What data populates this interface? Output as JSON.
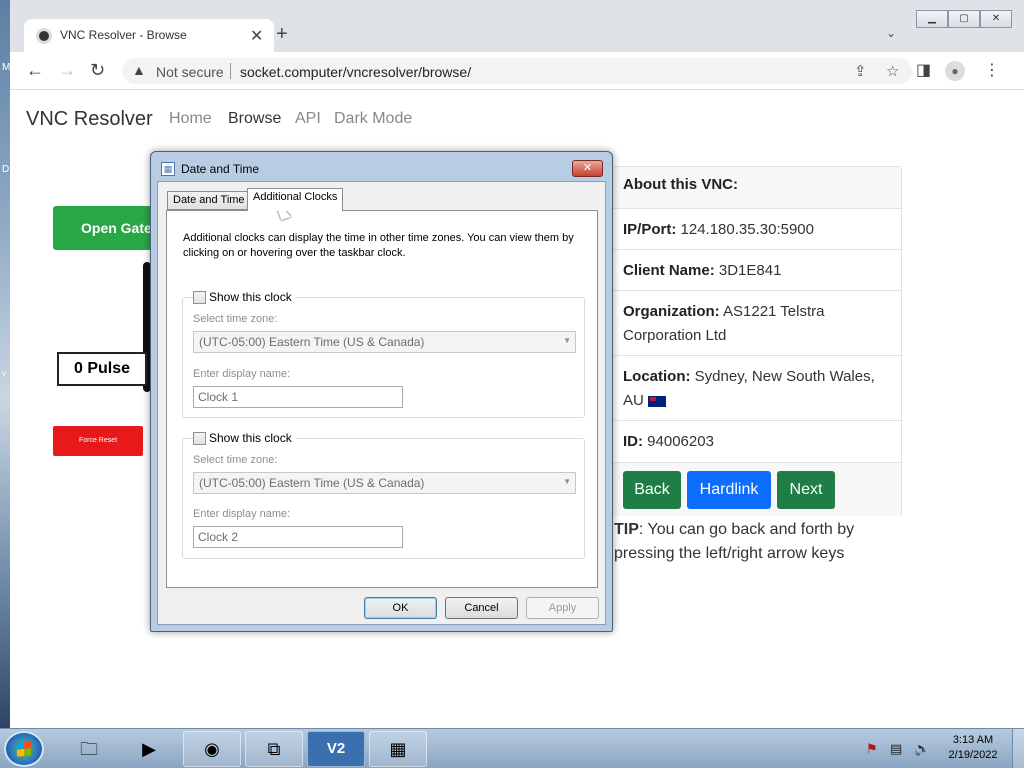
{
  "desktop": {
    "edge_letters": [
      "M",
      "D",
      "V"
    ]
  },
  "browser": {
    "tab_title": "VNC Resolver - Browse",
    "tab_close_glyph": "✕",
    "new_tab_glyph": "+",
    "tab_dropdown_glyph": "⌄",
    "window_controls": [
      "▁",
      "▢",
      "✕"
    ],
    "security_text": "Not secure",
    "url": "socket.computer/vncresolver/browse/"
  },
  "site": {
    "brand": "VNC Resolver",
    "nav": [
      "Home",
      "Browse",
      "API",
      "Dark Mode"
    ],
    "active_nav": "Browse",
    "open_gate_label": "Open Gate",
    "pulse_label": "0 Pulse",
    "force_reset_label": "Force Reset",
    "info": {
      "header": "About this VNC:",
      "ip_label": "IP/Port:",
      "ip_value": "124.180.35.30:5900",
      "client_label": "Client Name:",
      "client_value": "3D1E841",
      "org_label": "Organization:",
      "org_value": "AS1221 Telstra Corporation Ltd",
      "location_label": "Location:",
      "location_value": "Sydney, New South Wales, AU",
      "id_label": "ID:",
      "id_value": "94006203"
    },
    "buttons": {
      "back": "Back",
      "hardlink": "Hardlink",
      "next": "Next"
    },
    "tip_bold": "TIP",
    "tip_text": ": You can go back and forth by pressing the left/right arrow keys",
    "colors": {
      "green": "#1e7e45",
      "blue": "#0d6efd",
      "red": "#e8191a"
    }
  },
  "dialog": {
    "title": "Date and Time",
    "close_glyph": "✕",
    "tabs": [
      "Date and Time",
      "Additional Clocks"
    ],
    "active_tab": "Additional Clocks",
    "description": "Additional clocks can display the time in other time zones. You can view them by clicking on or hovering over the taskbar clock.",
    "clocks": [
      {
        "checkbox_label": "Show this clock",
        "checked": false,
        "tz_label": "Select time zone:",
        "tz_value": "(UTC-05:00) Eastern Time (US & Canada)",
        "name_label": "Enter display name:",
        "name_value": "Clock 1"
      },
      {
        "checkbox_label": "Show this clock",
        "checked": false,
        "tz_label": "Select time zone:",
        "tz_value": "(UTC-05:00) Eastern Time (US & Canada)",
        "name_label": "Enter display name:",
        "name_value": "Clock 2"
      }
    ],
    "ok": "OK",
    "cancel": "Cancel",
    "apply": "Apply"
  },
  "taskbar": {
    "apps": [
      "file-explorer",
      "media-player",
      "chrome",
      "network-tool",
      "vnc-viewer",
      "date-time-control-panel"
    ],
    "time": "3:13 AM",
    "date": "2/19/2022"
  }
}
